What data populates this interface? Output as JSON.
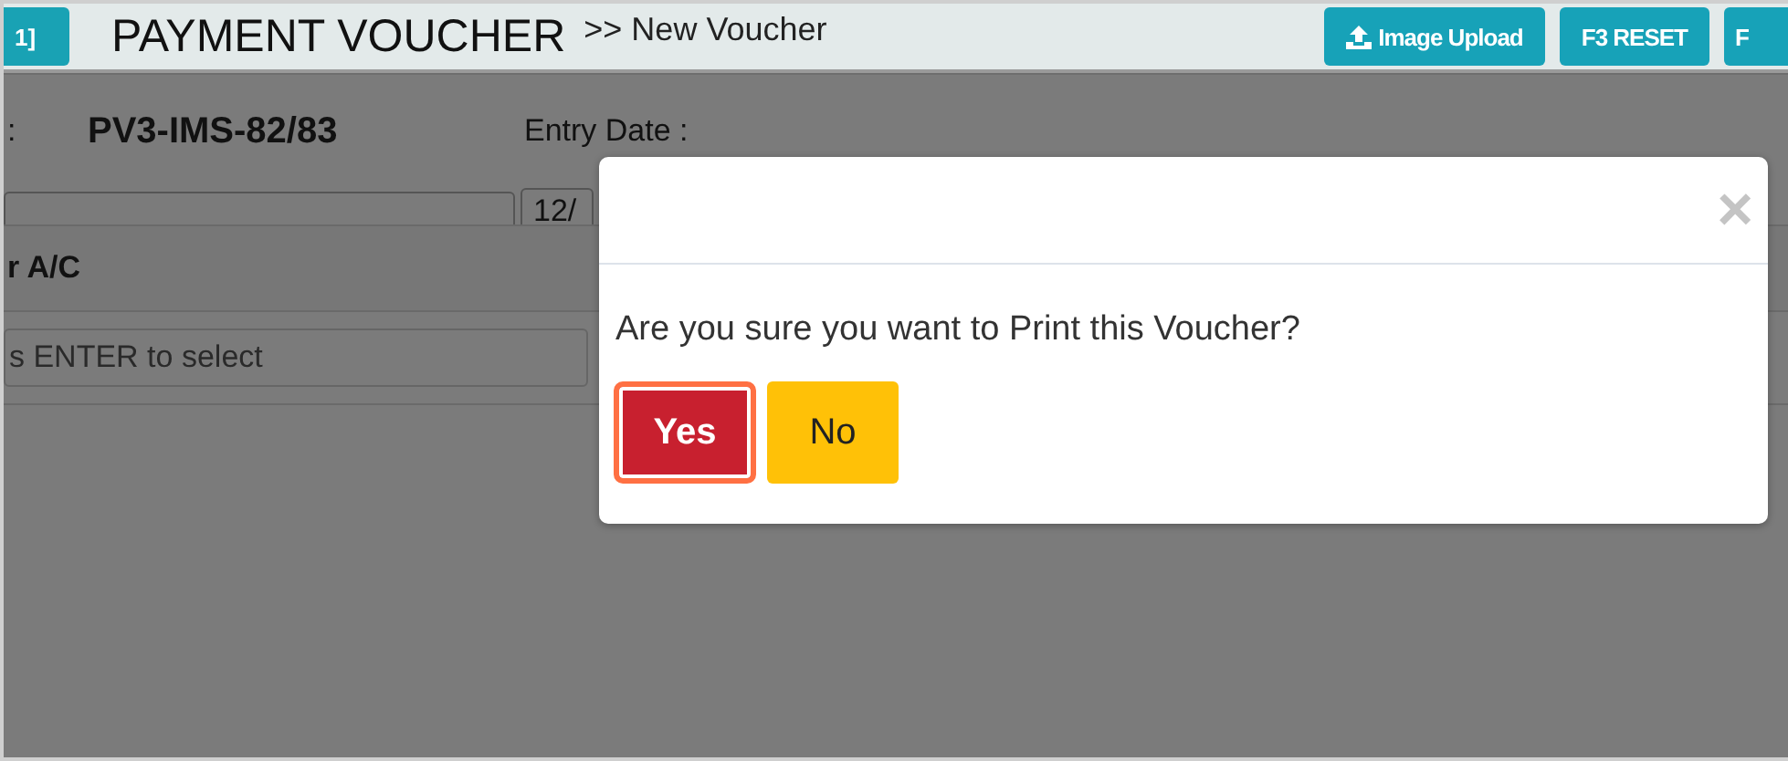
{
  "header": {
    "shortcut_button": "1]",
    "title": "PAYMENT VOUCHER",
    "breadcrumb": ">> New Voucher",
    "buttons": [
      {
        "label": "Image Upload",
        "kind": "upload"
      },
      {
        "label": "F3 RESET",
        "kind": "plain"
      },
      {
        "label": "F",
        "kind": "plain"
      }
    ]
  },
  "form": {
    "voucher_no_label": ":",
    "voucher_no": "PV3-IMS-82/83",
    "entry_date_label": "Entry Date :",
    "entry_date": "12/",
    "account_heading": "r A/C",
    "account_placeholder": "s ENTER to select"
  },
  "dialog": {
    "message": "Are you sure you want to Print this Voucher?",
    "close": "×",
    "buttons": [
      {
        "label": "Yes",
        "kind": "danger",
        "focused": true
      },
      {
        "label": "No",
        "kind": "warning",
        "focused": false
      }
    ]
  }
}
